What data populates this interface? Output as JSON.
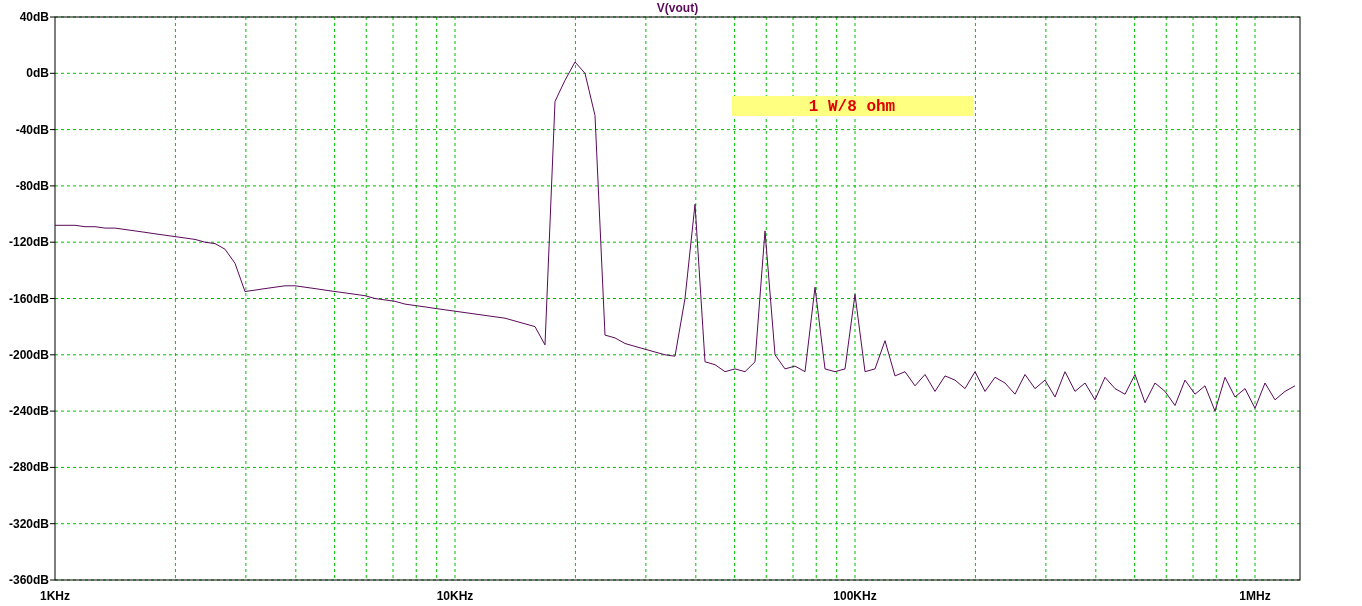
{
  "chart_data": {
    "type": "line",
    "grid": true,
    "ylim": [
      -360,
      40
    ],
    "categories": [
      "1KHz",
      null,
      null,
      null,
      null,
      null,
      null,
      null,
      null,
      null,
      null,
      null,
      null,
      null,
      null,
      null,
      null,
      null,
      null,
      null,
      null,
      null,
      null,
      null,
      null,
      null,
      null,
      null,
      null,
      null,
      null,
      null,
      null,
      null,
      null,
      null,
      null,
      null,
      null,
      null,
      "10KHz",
      null,
      null,
      null,
      null,
      null,
      null,
      null,
      null,
      null,
      null,
      null,
      null,
      null,
      null,
      null,
      null,
      null,
      null,
      null,
      null,
      null,
      null,
      null,
      null,
      null,
      null,
      null,
      null,
      null,
      null,
      null,
      null,
      null,
      null,
      null,
      null,
      null,
      null,
      null,
      "100KHz",
      null,
      null,
      null,
      null,
      null,
      null,
      null,
      null,
      null,
      null,
      null,
      null,
      null,
      null,
      null,
      null,
      null,
      null,
      null,
      null,
      null,
      null,
      null,
      null,
      null,
      null,
      null,
      null,
      null,
      null,
      null,
      null,
      null,
      null,
      null,
      null,
      null,
      null,
      null,
      "1MHz",
      null,
      null,
      null,
      null
    ],
    "yticks": [
      {
        "value": 40,
        "label": "40dB"
      },
      {
        "value": 0,
        "label": "0dB"
      },
      {
        "value": -40,
        "label": "-40dB"
      },
      {
        "value": -80,
        "label": "-80dB"
      },
      {
        "value": -120,
        "label": "-120dB"
      },
      {
        "value": -160,
        "label": "-160dB"
      },
      {
        "value": -200,
        "label": "-200dB"
      },
      {
        "value": -240,
        "label": "-240dB"
      },
      {
        "value": -280,
        "label": "-280dB"
      },
      {
        "value": -320,
        "label": "-320dB"
      },
      {
        "value": -360,
        "label": "-360dB"
      }
    ],
    "series": [
      {
        "name": "V(vout)",
        "color": "#5a0a5a",
        "values": [
          -108,
          -108,
          -108,
          -109,
          -109,
          -110,
          -110,
          -111,
          -112,
          -113,
          -114,
          -115,
          -116,
          -117,
          -118,
          -120,
          -121,
          -125,
          -135,
          -155,
          -154,
          -153,
          -152,
          -151,
          -151,
          -152,
          -153,
          -154,
          -155,
          -156,
          -157,
          -158,
          -160,
          -161,
          -162,
          -164,
          -165,
          -166,
          -167,
          -168,
          -169,
          -170,
          -171,
          -172,
          -173,
          -174,
          -176,
          -178,
          -180,
          -193,
          -20,
          -5,
          8,
          0,
          -30,
          -186,
          -188,
          -192,
          -194,
          -196,
          -198,
          -200,
          -201,
          -160,
          -93,
          -205,
          -207,
          -212,
          -210,
          -212,
          -205,
          -112,
          -200,
          -210,
          -208,
          -212,
          -152,
          -210,
          -212,
          -210,
          -157,
          -212,
          -210,
          -190,
          -215,
          -212,
          -222,
          -214,
          -226,
          -215,
          -218,
          -224,
          -212,
          -226,
          -216,
          -220,
          -228,
          -214,
          -224,
          -218,
          -230,
          -212,
          -226,
          -220,
          -232,
          -216,
          -224,
          -228,
          -214,
          -234,
          -220,
          -226,
          -236,
          -218,
          -228,
          -222,
          -240,
          -216,
          -230,
          -224,
          -238,
          -220,
          -232,
          -226,
          -222
        ]
      }
    ],
    "annotations": [
      "1 W/8 ohm"
    ]
  }
}
